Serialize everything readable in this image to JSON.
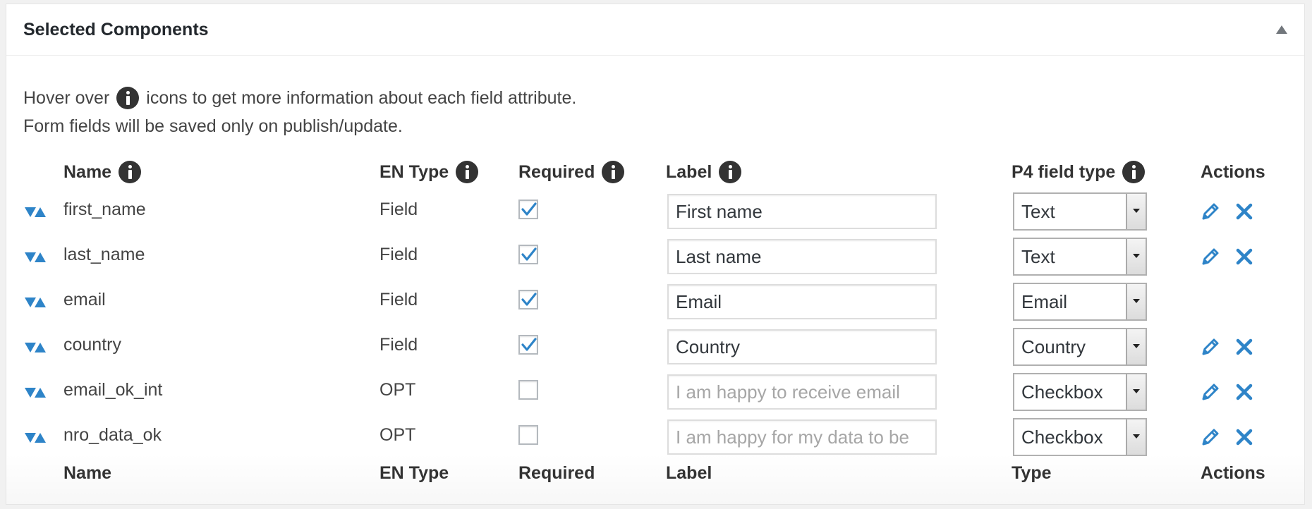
{
  "panel": {
    "title": "Selected Components"
  },
  "intro": {
    "line1_before": "Hover over",
    "line1_after": "icons to get more information about each field attribute.",
    "line2": "Form fields will be saved only on publish/update."
  },
  "header": {
    "name": "Name",
    "en_type": "EN Type",
    "required": "Required",
    "label": "Label",
    "p4_type": "P4 field type",
    "actions": "Actions"
  },
  "footer": {
    "name": "Name",
    "en_type": "EN Type",
    "required": "Required",
    "label": "Label",
    "type": "Type",
    "actions": "Actions"
  },
  "rows": [
    {
      "name": "first_name",
      "en_type": "Field",
      "required": true,
      "label_value": "First name",
      "label_placeholder": "",
      "p4_type": "Text",
      "actions": true
    },
    {
      "name": "last_name",
      "en_type": "Field",
      "required": true,
      "label_value": "Last name",
      "label_placeholder": "",
      "p4_type": "Text",
      "actions": true
    },
    {
      "name": "email",
      "en_type": "Field",
      "required": true,
      "label_value": "Email",
      "label_placeholder": "",
      "p4_type": "Email",
      "actions": false
    },
    {
      "name": "country",
      "en_type": "Field",
      "required": true,
      "label_value": "Country",
      "label_placeholder": "",
      "p4_type": "Country",
      "actions": true
    },
    {
      "name": "email_ok_int",
      "en_type": "OPT",
      "required": false,
      "label_value": "",
      "label_placeholder": "I am happy to receive email",
      "p4_type": "Checkbox",
      "actions": true
    },
    {
      "name": "nro_data_ok",
      "en_type": "OPT",
      "required": false,
      "label_value": "",
      "label_placeholder": "I am happy for my data to be",
      "p4_type": "Checkbox",
      "actions": true
    }
  ],
  "colors": {
    "accent": "#2e84c8",
    "text": "#444444",
    "heading": "#23282d"
  },
  "icons": {
    "info": "info-icon",
    "sort": "sort-arrows-icon",
    "edit": "pencil-icon",
    "delete": "close-icon",
    "collapse": "triangle-up-icon"
  }
}
